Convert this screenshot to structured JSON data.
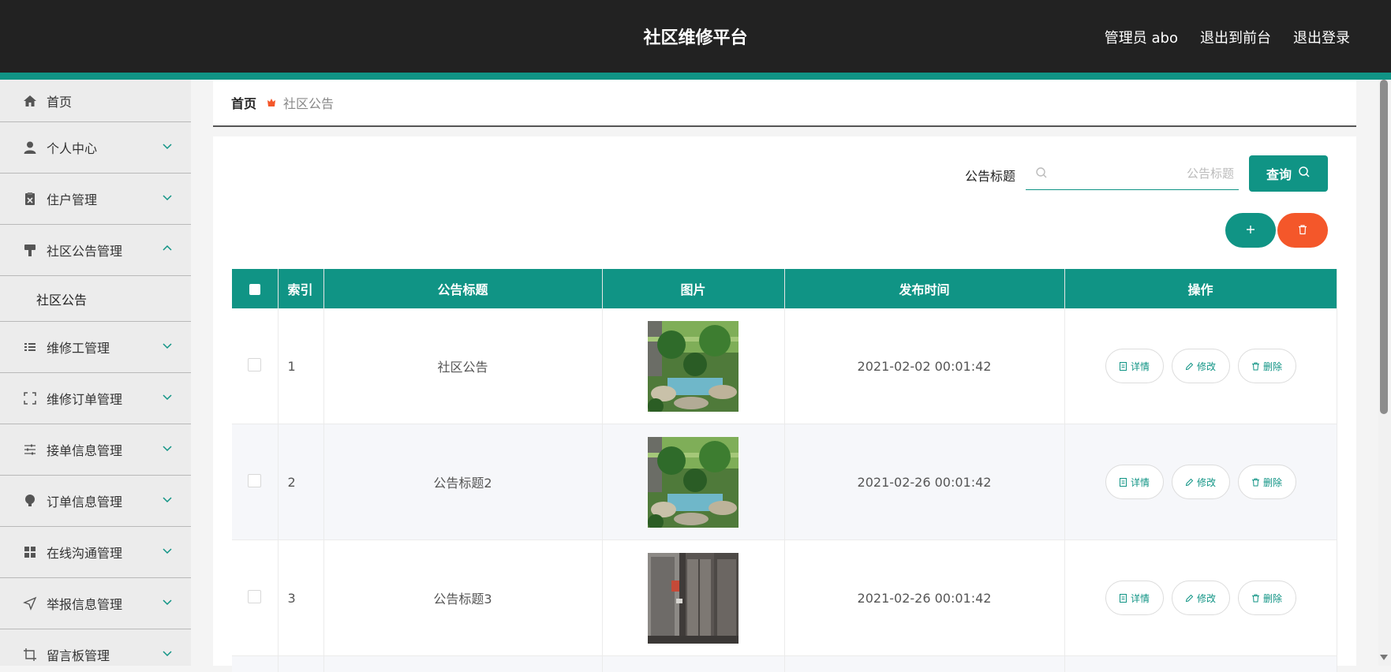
{
  "header": {
    "app_title": "社区维修平台",
    "user_label": "管理员 abo",
    "front_link": "退出到前台",
    "logout_link": "退出登录"
  },
  "sidebar": {
    "items": [
      {
        "label": "首页",
        "icon": "home-icon"
      },
      {
        "label": "个人中心",
        "icon": "user-icon"
      },
      {
        "label": "住户管理",
        "icon": "clipboard-icon"
      },
      {
        "label": "社区公告管理",
        "icon": "brush-icon",
        "expanded": true,
        "children": [
          "社区公告"
        ]
      },
      {
        "label": "维修工管理",
        "icon": "list-icon"
      },
      {
        "label": "维修订单管理",
        "icon": "fullscreen-icon"
      },
      {
        "label": "接单信息管理",
        "icon": "sliders-icon"
      },
      {
        "label": "订单信息管理",
        "icon": "bulb-icon"
      },
      {
        "label": "在线沟通管理",
        "icon": "grid-icon"
      },
      {
        "label": "举报信息管理",
        "icon": "send-icon"
      },
      {
        "label": "留言板管理",
        "icon": "crop-icon"
      }
    ]
  },
  "breadcrumb": {
    "home": "首页",
    "current": "社区公告"
  },
  "search": {
    "label": "公告标题",
    "placeholder": "公告标题",
    "button_label": "查询"
  },
  "table": {
    "columns": [
      "索引",
      "公告标题",
      "图片",
      "发布时间",
      "操作"
    ],
    "rows": [
      {
        "index": "1",
        "title": "社区公告",
        "image": "garden-photo",
        "time": "2021-02-02 00:01:42"
      },
      {
        "index": "2",
        "title": "公告标题2",
        "image": "garden-photo",
        "time": "2021-02-26 00:01:42"
      },
      {
        "index": "3",
        "title": "公告标题3",
        "image": "elevator-photo",
        "time": "2021-02-26 00:01:42"
      }
    ],
    "actions": {
      "detail": "详情",
      "edit": "修改",
      "delete": "删除"
    }
  },
  "colors": {
    "accent": "#109485",
    "danger": "#f4572a",
    "header_bg": "#222222",
    "sidebar_bg": "#ececec"
  }
}
